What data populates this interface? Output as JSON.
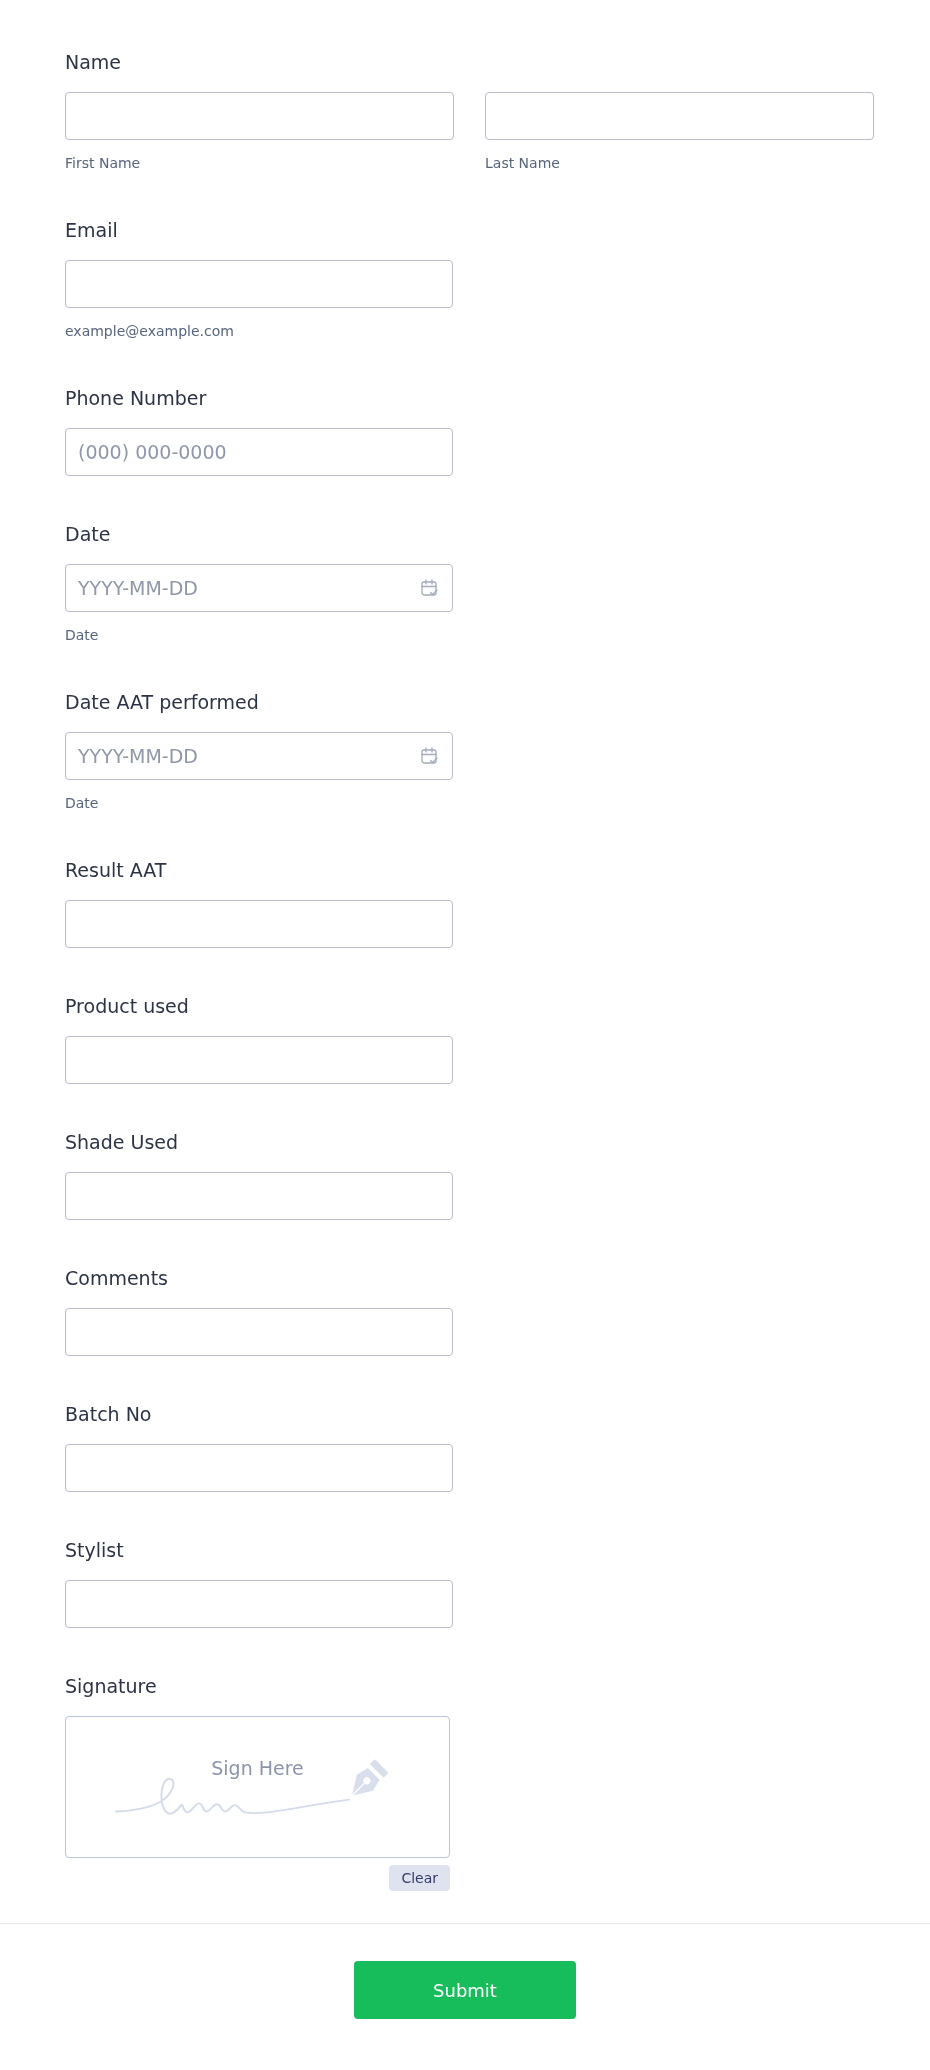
{
  "fields": [
    {
      "kind": "name",
      "label": "Name",
      "parts": [
        {
          "sublabel": "First Name"
        },
        {
          "sublabel": "Last Name"
        }
      ]
    },
    {
      "kind": "text",
      "label": "Email",
      "sublabel": "example@example.com"
    },
    {
      "kind": "text",
      "label": "Phone Number",
      "placeholder": "(000) 000-0000"
    },
    {
      "kind": "date",
      "label": "Date",
      "placeholder": "YYYY-MM-DD",
      "sublabel": "Date"
    },
    {
      "kind": "date",
      "label": "Date AAT performed",
      "placeholder": "YYYY-MM-DD",
      "sublabel": "Date"
    },
    {
      "kind": "text",
      "label": "Result AAT"
    },
    {
      "kind": "text",
      "label": "Product used"
    },
    {
      "kind": "text",
      "label": "Shade Used"
    },
    {
      "kind": "text",
      "label": "Comments"
    },
    {
      "kind": "text",
      "label": "Batch No"
    },
    {
      "kind": "text",
      "label": "Stylist"
    },
    {
      "kind": "signature",
      "label": "Signature",
      "prompt": "Sign Here",
      "clear_button": "Clear"
    }
  ],
  "submit_button": "Submit"
}
